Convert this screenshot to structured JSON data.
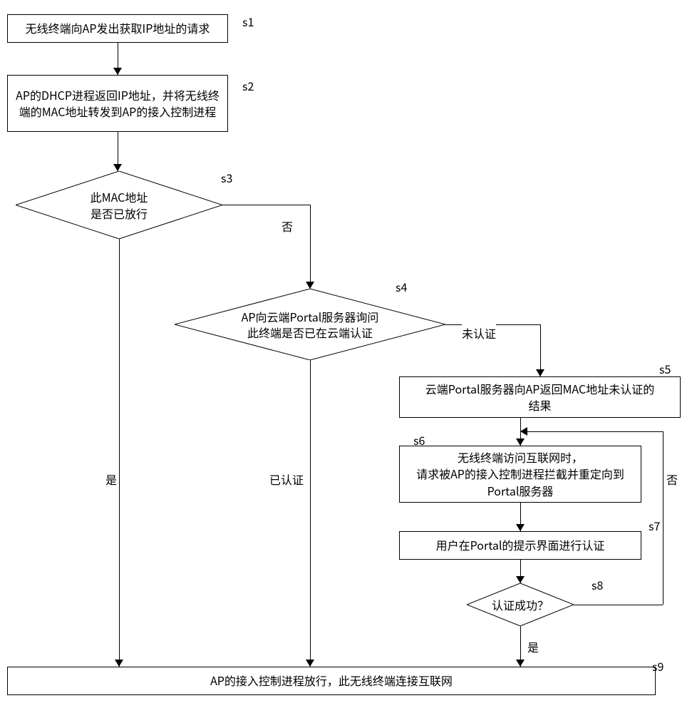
{
  "nodes": {
    "s1": {
      "label": "s1",
      "text": "无线终端向AP发出获取IP地址的请求"
    },
    "s2": {
      "label": "s2",
      "text": "AP的DHCP进程返回IP地址，并将无线终端的MAC地址转发到AP的接入控制进程"
    },
    "s3": {
      "label": "s3",
      "text_line1": "此MAC地址",
      "text_line2": "是否已放行"
    },
    "s4": {
      "label": "s4",
      "text_line1": "AP向云端Portal服务器询问",
      "text_line2": "此终端是否已在云端认证"
    },
    "s5": {
      "label": "s5",
      "text_line1": "云端Portal服务器向AP返回MAC地址未认证的",
      "text_line2": "结果"
    },
    "s6": {
      "label": "s6",
      "text_line1": "无线终端访问互联网时，",
      "text_line2": "请求被AP的接入控制进程拦截并重定向到",
      "text_line3": "Portal服务器"
    },
    "s7": {
      "label": "s7",
      "text": "用户在Portal的提示界面进行认证"
    },
    "s8": {
      "label": "s8",
      "text": "认证成功？"
    },
    "s9": {
      "label": "s9",
      "text": "AP的接入控制进程放行，此无线终端连接互联网"
    }
  },
  "edges": {
    "s3_yes": "是",
    "s3_no": "否",
    "s4_no": "未认证",
    "s4_yes": "已认证",
    "s8_yes": "是",
    "s8_no": "否"
  }
}
